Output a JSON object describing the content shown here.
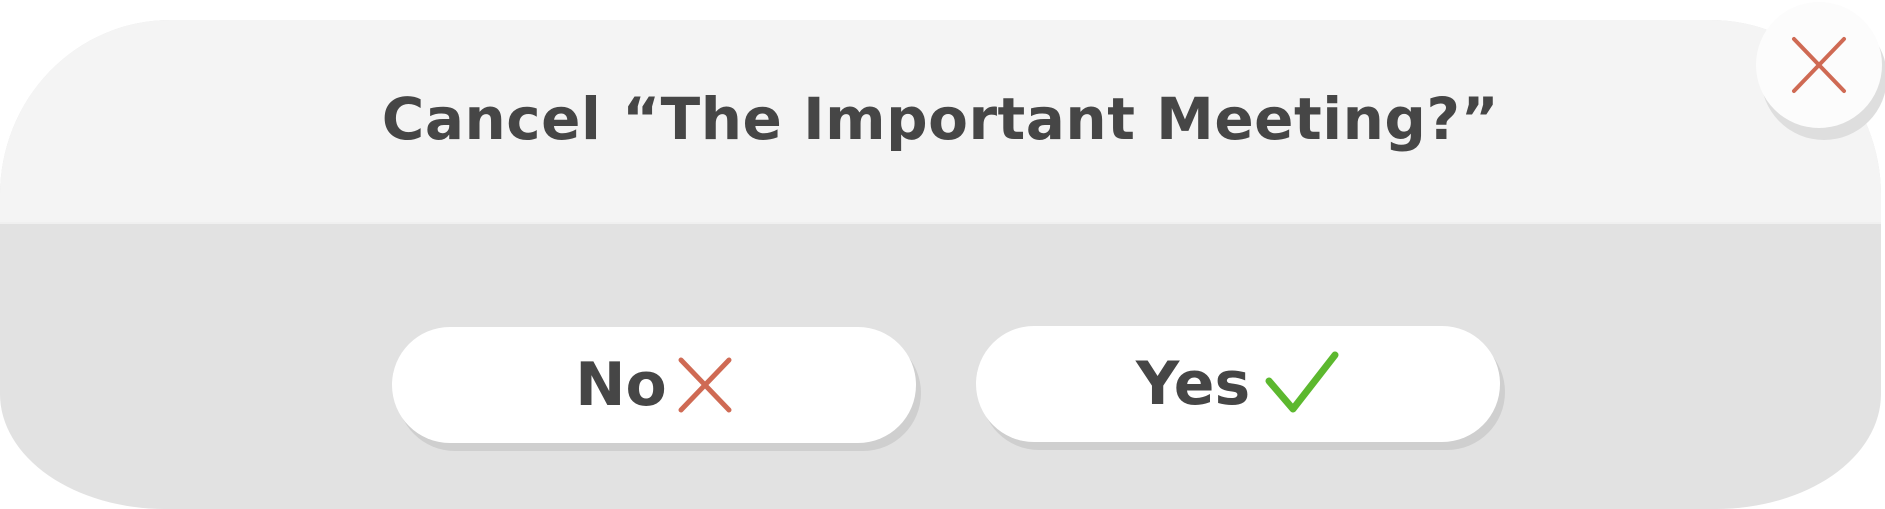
{
  "dialog": {
    "title": "Cancel “The Important Meeting?”",
    "close_icon": "close-icon"
  },
  "buttons": {
    "no": {
      "label": "No",
      "icon": "x-mark-icon"
    },
    "yes": {
      "label": "Yes",
      "icon": "check-mark-icon"
    }
  },
  "colors": {
    "header_bg": "#f4f4f4",
    "body_bg": "#e2e2e2",
    "text": "#464646",
    "cross": "#cf6a54",
    "check": "#5cb82e"
  }
}
